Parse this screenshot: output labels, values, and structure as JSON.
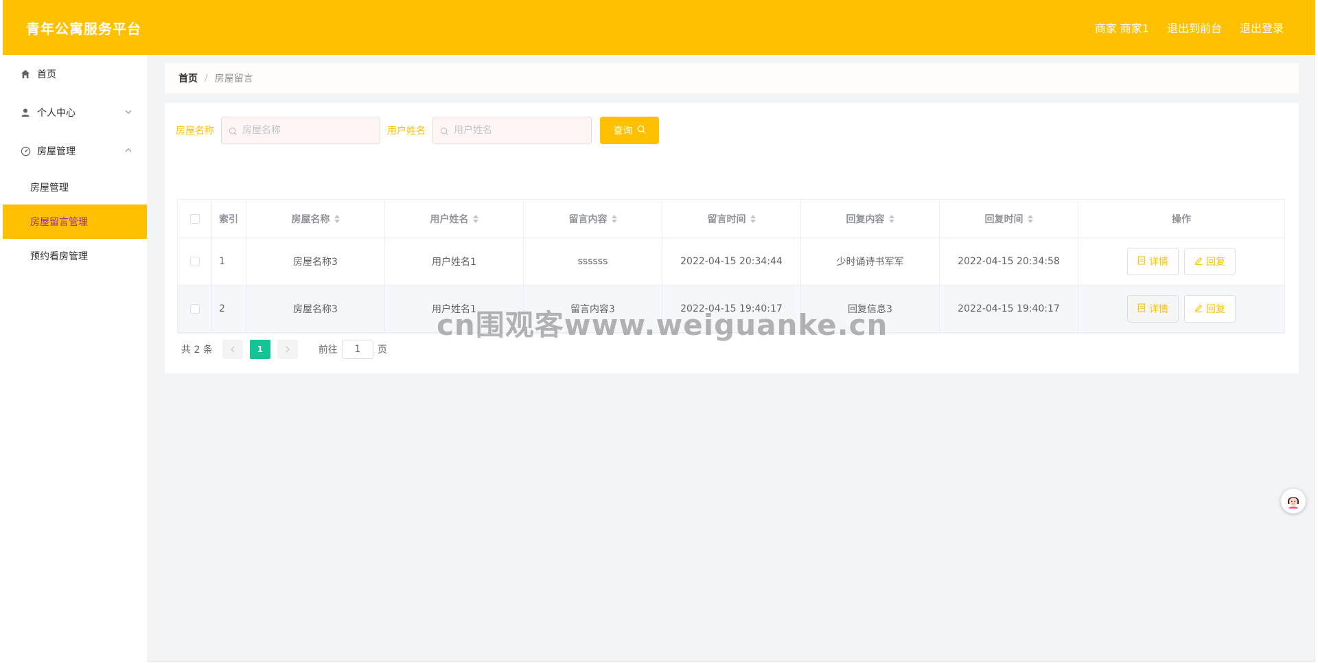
{
  "header": {
    "brand": "青年公寓服务平台",
    "user": "商家 商家1",
    "to_front": "退出到前台",
    "logout": "退出登录"
  },
  "sidebar": {
    "items": [
      {
        "label": "首页",
        "icon": "home-icon"
      },
      {
        "label": "个人中心",
        "icon": "user-icon",
        "expanded": false
      },
      {
        "label": "房屋管理",
        "icon": "gauge-icon",
        "expanded": true
      }
    ],
    "sub_items": [
      {
        "label": "房屋管理",
        "active": false
      },
      {
        "label": "房屋留言管理",
        "active": true
      },
      {
        "label": "预约看房管理",
        "active": false
      }
    ]
  },
  "breadcrumb": {
    "home": "首页",
    "separator": "/",
    "current": "房屋留言"
  },
  "filters": {
    "house_label": "房屋名称",
    "house_placeholder": "房屋名称",
    "user_label": "用户姓名",
    "user_placeholder": "用户姓名",
    "query_label": "查询"
  },
  "table": {
    "headers": [
      "索引",
      "房屋名称",
      "用户姓名",
      "留言内容",
      "留言时间",
      "回复内容",
      "回复时间",
      "操作"
    ],
    "rows": [
      {
        "index": "1",
        "house": "房屋名称3",
        "user": "用户姓名1",
        "message": "ssssss",
        "msg_time": "2022-04-15 20:34:44",
        "reply": "少时诵诗书军军",
        "reply_time": "2022-04-15 20:34:58"
      },
      {
        "index": "2",
        "house": "房屋名称3",
        "user": "用户姓名1",
        "message": "留言内容3",
        "msg_time": "2022-04-15 19:40:17",
        "reply": "回复信息3",
        "reply_time": "2022-04-15 19:40:17"
      }
    ],
    "detail_label": "详情",
    "reply_label": "回复"
  },
  "pagination": {
    "total": "共 2 条",
    "current_page": "1",
    "goto_label": "前往",
    "goto_value": "1",
    "page_suffix": "页"
  },
  "watermark": "cn围观客www.weiguanke.cn",
  "colors": {
    "primary": "#FFC001",
    "active_text": "#9c27b0",
    "pager_active": "#13c495"
  }
}
